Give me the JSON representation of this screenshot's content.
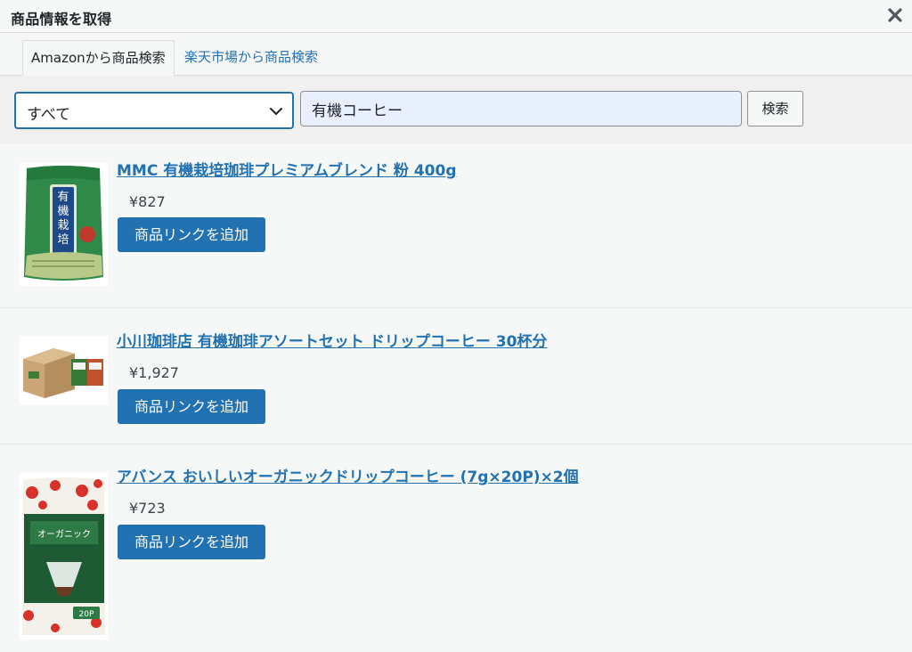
{
  "dialog": {
    "title": "商品情報を取得"
  },
  "tabs": [
    {
      "label": "Amazonから商品検索",
      "active": true
    },
    {
      "label": "楽天市場から商品検索",
      "active": false
    }
  ],
  "search": {
    "category_selected": "すべて",
    "query": "有機コーヒー",
    "button_label": "検索"
  },
  "results": [
    {
      "title": "MMC 有機栽培珈琲プレミアムブレンド 粉 400g",
      "price": "¥827",
      "add_label": "商品リンクを追加"
    },
    {
      "title": "小川珈琲店 有機珈琲アソートセット ドリップコーヒー 30杯分",
      "price": "¥1,927",
      "add_label": "商品リンクを追加"
    },
    {
      "title": "アバンス おいしいオーガニックドリップコーヒー (7g×20P)×2個",
      "price": "¥723",
      "add_label": "商品リンクを追加"
    }
  ],
  "colors": {
    "accent": "#2271b1",
    "link": "#2271b1",
    "panel": "#f6f7f7",
    "searchbar": "#f0f0f1"
  },
  "icons": {
    "close": "close-icon",
    "chevron": "chevron-down-icon"
  }
}
